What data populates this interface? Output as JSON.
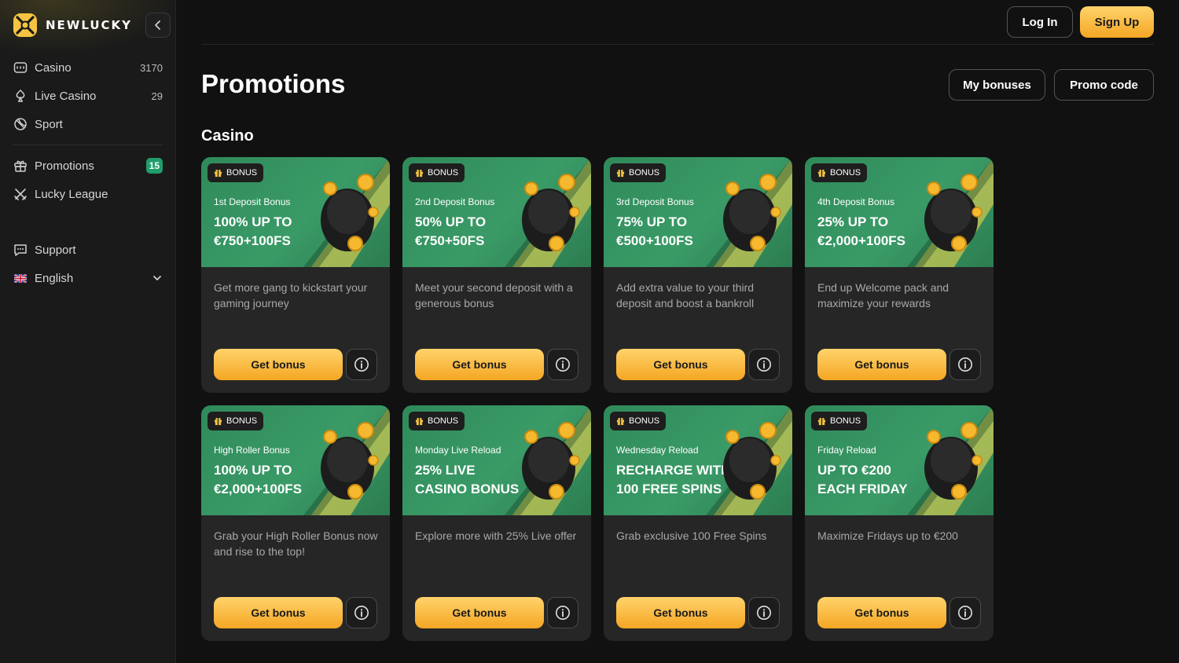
{
  "brand": {
    "name": "NEWLUCKY"
  },
  "sidebar": {
    "main_items": [
      {
        "label": "Casino",
        "count": "3170",
        "icon": "casino-icon"
      },
      {
        "label": "Live Casino",
        "count": "29",
        "icon": "live-casino-icon"
      },
      {
        "label": "Sport",
        "icon": "sport-icon"
      }
    ],
    "promo_items": [
      {
        "label": "Promotions",
        "badge": "15",
        "icon": "gift-icon"
      },
      {
        "label": "Lucky League",
        "icon": "crossed-swords-icon"
      }
    ],
    "support_label": "Support",
    "language_label": "English"
  },
  "header": {
    "login_label": "Log In",
    "signup_label": "Sign Up"
  },
  "page": {
    "title": "Promotions",
    "my_bonuses_label": "My bonuses",
    "promo_code_label": "Promo code",
    "section_title": "Casino"
  },
  "cards": [
    {
      "tag": "BONUS",
      "subtitle": "1st Deposit Bonus",
      "headline_1": "100% UP TO",
      "headline_2": "€750+100FS",
      "description": "Get more gang to kickstart your gaming journey",
      "button": "Get bonus",
      "art": "wallet-coins-icon"
    },
    {
      "tag": "BONUS",
      "subtitle": "2nd Deposit Bonus",
      "headline_1": "50% UP TO",
      "headline_2": "€750+50FS",
      "description": "Meet your second deposit with a generous bonus",
      "button": "Get bonus",
      "art": "pot-of-gold-icon"
    },
    {
      "tag": "BONUS",
      "subtitle": "3rd Deposit Bonus",
      "headline_1": "75% UP TO",
      "headline_2": "€500+100FS",
      "description": "Add extra value to your third deposit and boost a bankroll",
      "button": "Get bonus",
      "art": "safe-coins-icon"
    },
    {
      "tag": "BONUS",
      "subtitle": "4th Deposit Bonus",
      "headline_1": "25% UP TO",
      "headline_2": "€2,000+100FS",
      "description": "End up Welcome pack and maximize your rewards",
      "button": "Get bonus",
      "art": "money-bag-icon"
    },
    {
      "tag": "BONUS",
      "subtitle": "High Roller Bonus",
      "headline_1": "100% UP TO",
      "headline_2": "€2,000+100FS",
      "description": "Grab your High Roller Bonus now and rise to the top!",
      "button": "Get bonus",
      "art": "poker-chip-clubs-icon"
    },
    {
      "tag": "BONUS",
      "subtitle": "Monday Live Reload",
      "headline_1": "25% LIVE",
      "headline_2": "CASINO BONUS",
      "description": "Explore more with 25% Live offer",
      "button": "Get bonus",
      "art": "playing-cards-heart-icon"
    },
    {
      "tag": "BONUS",
      "subtitle": "Wednesday Reload",
      "headline_1": "RECHARGE WITH",
      "headline_2": "100 FREE SPINS",
      "description": "Grab exclusive 100 Free Spins",
      "button": "Get bonus",
      "art": "slot-machine-icon"
    },
    {
      "tag": "BONUS",
      "subtitle": "Friday Reload",
      "headline_1": "UP TO €200",
      "headline_2": "EACH FRIDAY",
      "description": "Maximize Fridays up to €200",
      "button": "Get bonus",
      "art": "gift-box-coins-icon"
    }
  ],
  "colors": {
    "accent_yellow": "#f5a623",
    "banner_green": "#3a9b67",
    "badge_green": "#1f9d6b"
  }
}
